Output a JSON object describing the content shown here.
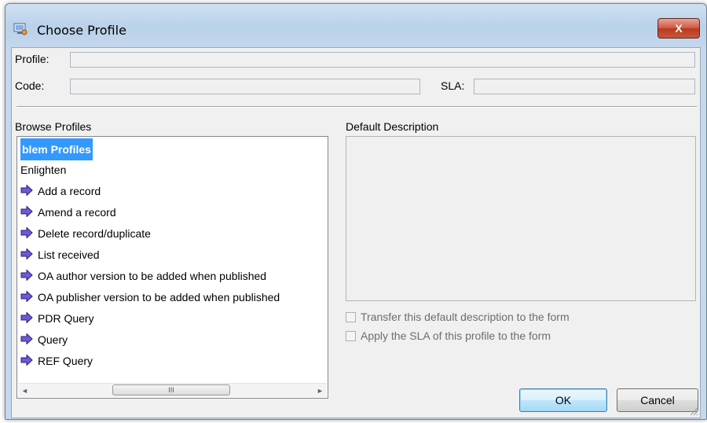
{
  "window": {
    "title": "Choose Profile",
    "close_glyph": "X",
    "icon": "profile-window-icon"
  },
  "form": {
    "profile_label": "Profile:",
    "profile_value": "",
    "code_label": "Code:",
    "code_value": "",
    "sla_label": "SLA:",
    "sla_value": ""
  },
  "browse": {
    "label": "Browse Profiles",
    "items": [
      {
        "label": "blem Profiles",
        "selected": true,
        "icon": null
      },
      {
        "label": "Enlighten",
        "selected": false,
        "icon": null
      },
      {
        "label": "Add a record",
        "selected": false,
        "icon": "arrow-right-icon"
      },
      {
        "label": "Amend a record",
        "selected": false,
        "icon": "arrow-right-icon"
      },
      {
        "label": "Delete record/duplicate",
        "selected": false,
        "icon": "arrow-right-icon"
      },
      {
        "label": "List received",
        "selected": false,
        "icon": "arrow-right-icon"
      },
      {
        "label": "OA author version to be added when published",
        "selected": false,
        "icon": "arrow-right-icon"
      },
      {
        "label": "OA publisher version to be added when published",
        "selected": false,
        "icon": "arrow-right-icon"
      },
      {
        "label": "PDR Query",
        "selected": false,
        "icon": "arrow-right-icon"
      },
      {
        "label": "Query",
        "selected": false,
        "icon": "arrow-right-icon"
      },
      {
        "label": "REF Query",
        "selected": false,
        "icon": "arrow-right-icon"
      }
    ],
    "scroll_left_glyph": "◄",
    "scroll_right_glyph": "►",
    "thumb_grip": "III"
  },
  "description": {
    "label": "Default Description",
    "value": ""
  },
  "options": {
    "transfer_label": "Transfer this default description to the form",
    "transfer_checked": false,
    "apply_sla_label": "Apply the SLA of this profile to the form",
    "apply_sla_checked": false
  },
  "buttons": {
    "ok": "OK",
    "cancel": "Cancel"
  },
  "colors": {
    "selection": "#3399ff",
    "arrow_fill": "#6b5bd6",
    "close_button": "#c9563a"
  }
}
